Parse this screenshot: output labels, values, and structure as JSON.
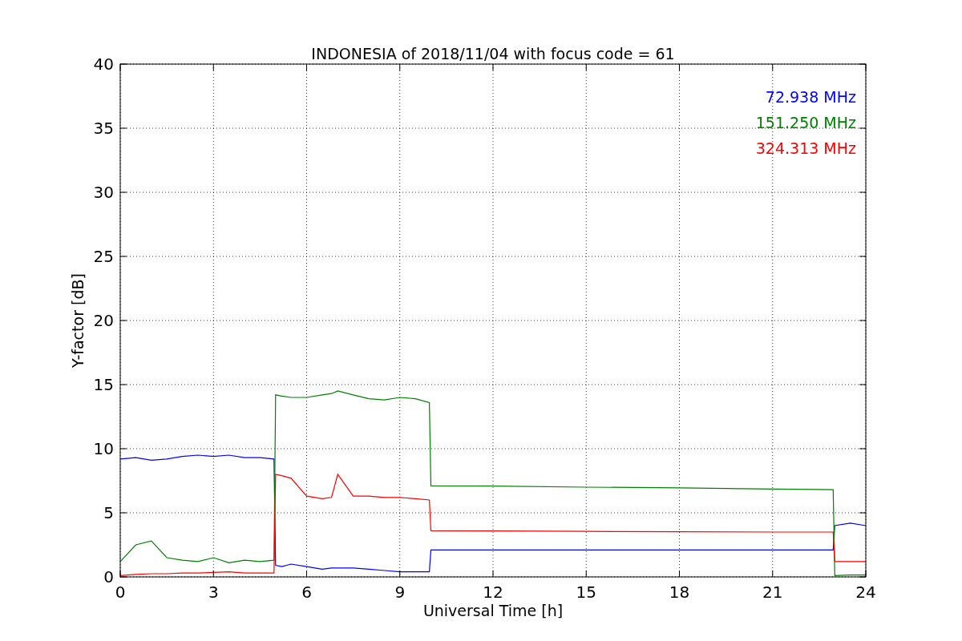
{
  "chart_data": {
    "type": "line",
    "title": "INDONESIA of 2018/11/04 with focus code = 61",
    "xlabel": "Universal Time [h]",
    "ylabel": "Y-factor [dB]",
    "x": [
      0,
      0.5,
      1,
      1.5,
      2,
      2.5,
      3,
      3.5,
      4,
      4.5,
      4.95,
      5,
      5.2,
      5.5,
      6,
      6.5,
      6.8,
      7,
      7.5,
      8,
      8.5,
      9,
      9.5,
      9.95,
      10,
      12,
      15,
      18,
      21,
      22.95,
      23,
      23.5,
      24
    ],
    "series": [
      {
        "name": "72.938 MHz",
        "color": "#0000ff",
        "values": [
          9.2,
          9.3,
          9.1,
          9.2,
          9.4,
          9.5,
          9.4,
          9.5,
          9.3,
          9.3,
          9.2,
          0.9,
          0.8,
          1.0,
          0.8,
          0.6,
          0.7,
          0.7,
          0.7,
          0.6,
          0.5,
          0.4,
          0.4,
          0.4,
          2.1,
          2.1,
          2.1,
          2.1,
          2.1,
          2.1,
          4.0,
          4.2,
          4.0
        ]
      },
      {
        "name": "151.250 MHz",
        "color": "#008000",
        "values": [
          1.2,
          2.5,
          2.8,
          1.5,
          1.3,
          1.2,
          1.5,
          1.1,
          1.3,
          1.2,
          1.3,
          14.2,
          14.1,
          14.0,
          14.0,
          14.2,
          14.3,
          14.5,
          14.2,
          13.9,
          13.8,
          14.0,
          13.9,
          13.6,
          7.1,
          7.08,
          7.0,
          6.95,
          6.85,
          6.8,
          0.1,
          0.15,
          0.15
        ]
      },
      {
        "name": "324.313 MHz",
        "color": "#ff0000",
        "values": [
          0.1,
          0.2,
          0.25,
          0.25,
          0.3,
          0.3,
          0.35,
          0.4,
          0.3,
          0.3,
          0.3,
          8.0,
          7.9,
          7.7,
          6.3,
          6.1,
          6.2,
          8.0,
          6.3,
          6.3,
          6.2,
          6.2,
          6.1,
          6.0,
          3.6,
          3.58,
          3.55,
          3.52,
          3.5,
          3.5,
          1.2,
          1.2,
          1.2
        ]
      }
    ],
    "grid": true,
    "xlim": [
      0,
      24
    ],
    "ylim": [
      0,
      40
    ],
    "xticks": [
      0,
      3,
      6,
      9,
      12,
      15,
      18,
      21,
      24
    ],
    "yticks": [
      0,
      5,
      10,
      15,
      20,
      25,
      30,
      35,
      40
    ]
  }
}
